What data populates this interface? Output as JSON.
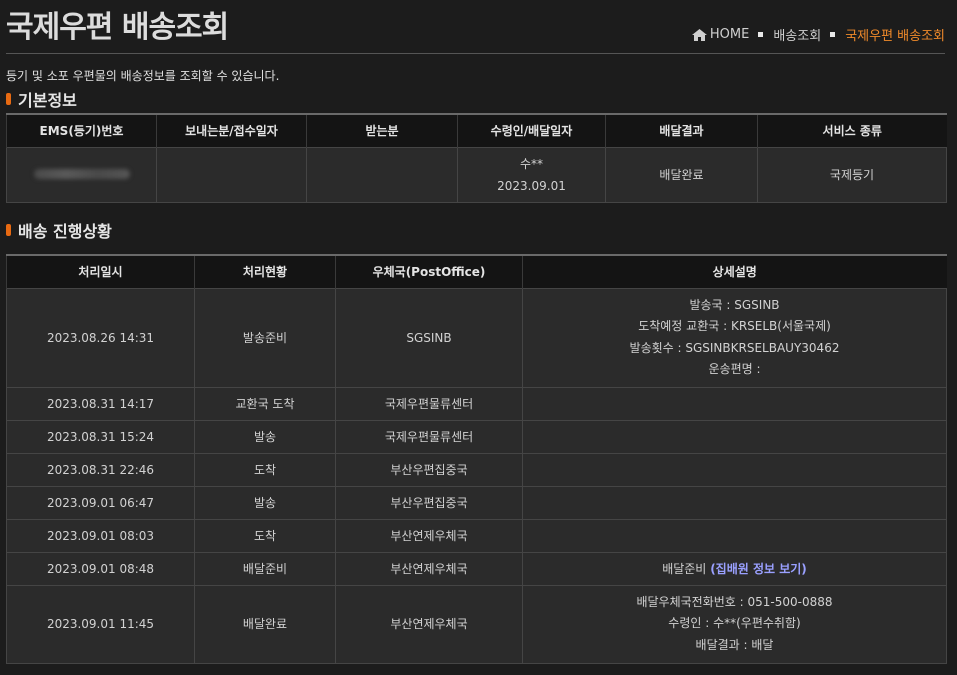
{
  "header": {
    "title": "국제우편 배송조회",
    "breadcrumb": {
      "home": "HOME",
      "level1": "배송조회",
      "current": "국제우편 배송조회"
    }
  },
  "intro": "등기 및 소포 우편물의 배송정보를 조회할 수 있습니다.",
  "basic_info": {
    "title": "기본정보",
    "headers": [
      "EMS(등기)번호",
      "보내는분/접수일자",
      "받는분",
      "수령인/배달일자",
      "배달결과",
      "서비스 종류"
    ],
    "row": {
      "tracking_number": "LP257123585156",
      "sender": "",
      "receiver": "",
      "recipient": "수**",
      "delivery_date": "2023.09.01",
      "result": "배달완료",
      "service": "국제등기"
    }
  },
  "progress": {
    "title": "배송 진행상황",
    "headers": [
      "처리일시",
      "처리현황",
      "우체국(PostOffice)",
      "상세설명"
    ],
    "rows": [
      {
        "datetime": "2023.08.26 14:31",
        "status": "발송준비",
        "office": "SGSINB",
        "details": [
          "발송국 : SGSINB",
          "도착예정 교환국 : KRSELB(서울국제)",
          "발송횟수 : SGSINBKRSELBAUY30462",
          "운송편명 :"
        ]
      },
      {
        "datetime": "2023.08.31 14:17",
        "status": "교환국 도착",
        "office": "국제우편물류센터",
        "details": []
      },
      {
        "datetime": "2023.08.31 15:24",
        "status": "발송",
        "office": "국제우편물류센터",
        "details": []
      },
      {
        "datetime": "2023.08.31 22:46",
        "status": "도착",
        "office": "부산우편집중국",
        "details": []
      },
      {
        "datetime": "2023.09.01 06:47",
        "status": "발송",
        "office": "부산우편집중국",
        "details": []
      },
      {
        "datetime": "2023.09.01 08:03",
        "status": "도착",
        "office": "부산연제우체국",
        "details": []
      },
      {
        "datetime": "2023.09.01 08:48",
        "status": "배달준비",
        "office": "부산연제우체국",
        "detail_text": "배달준비",
        "detail_link": "(집배원 정보 보기)"
      },
      {
        "datetime": "2023.09.01 11:45",
        "status": "배달완료",
        "office": "부산연제우체국",
        "details": [
          "배달우체국전화번호 : 051-500-0888",
          "수령인 : 수**(우편수취함)",
          "배달결과 : 배달"
        ]
      }
    ]
  },
  "colors": {
    "accent": "#f08a2a",
    "bullet": "#e86a12",
    "link": "#9aa0ff",
    "background": "#1c1c1c"
  }
}
